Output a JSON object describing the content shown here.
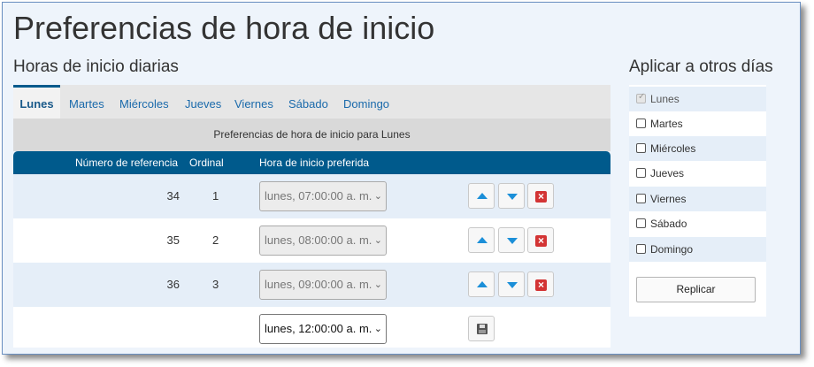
{
  "page": {
    "title": "Preferencias de hora de inicio"
  },
  "daily": {
    "section_title": "Horas de inicio diarias",
    "tabs": [
      {
        "label": "Lunes",
        "active": true
      },
      {
        "label": "Martes",
        "active": false
      },
      {
        "label": "Miércoles",
        "active": false
      },
      {
        "label": "Jueves",
        "active": false
      },
      {
        "label": "Viernes",
        "active": false
      },
      {
        "label": "Sábado",
        "active": false
      },
      {
        "label": "Domingo",
        "active": false
      }
    ],
    "caption": "Preferencias de hora de inicio para Lunes",
    "columns": [
      "Número de referencia",
      "Ordinal",
      "Hora de inicio preferida"
    ],
    "rows": [
      {
        "ref": "34",
        "ordinal": "1",
        "time": "lunes, 07:00:00 a. m."
      },
      {
        "ref": "35",
        "ordinal": "2",
        "time": "lunes, 08:00:00 a. m."
      },
      {
        "ref": "36",
        "ordinal": "3",
        "time": "lunes, 09:00:00 a. m."
      }
    ],
    "new_row": {
      "time": "lunes, 12:00:00 a. m."
    }
  },
  "apply": {
    "title": "Aplicar a otros días",
    "days": [
      {
        "label": "Lunes",
        "checked": true,
        "disabled": true
      },
      {
        "label": "Martes",
        "checked": false,
        "disabled": false
      },
      {
        "label": "Miércoles",
        "checked": false,
        "disabled": false
      },
      {
        "label": "Jueves",
        "checked": false,
        "disabled": false
      },
      {
        "label": "Viernes",
        "checked": false,
        "disabled": false
      },
      {
        "label": "Sábado",
        "checked": false,
        "disabled": false
      },
      {
        "label": "Domingo",
        "checked": false,
        "disabled": false
      }
    ],
    "button_label": "Replicar"
  },
  "colors": {
    "header_blue": "#005a8c",
    "row_shade": "#e5eef8",
    "delete_red": "#d33434",
    "arrow_blue": "#1b8fd8"
  },
  "icons": {
    "move_up": "arrow-up-icon",
    "move_down": "arrow-down-icon",
    "delete": "delete-icon",
    "save": "save-icon",
    "dropdown": "chevron-down-icon"
  }
}
